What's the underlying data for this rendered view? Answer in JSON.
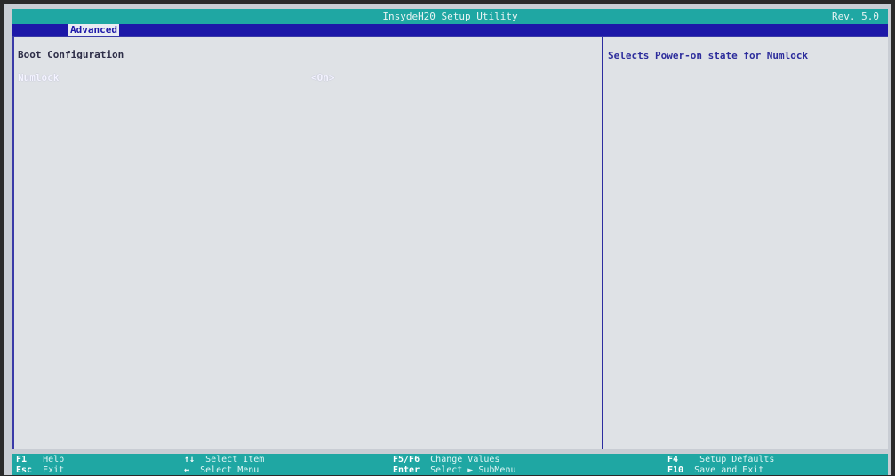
{
  "title": "InsydeH20 Setup Utility",
  "revision": "Rev. 5.0",
  "active_tab": "Advanced",
  "section_title": "Boot Configuration",
  "options": [
    {
      "label": "Numlock",
      "value": "<On>"
    }
  ],
  "help_text": "Selects Power-on state for Numlock",
  "footer": {
    "col1": [
      {
        "key": "F1",
        "desc": "Help"
      },
      {
        "key": "Esc",
        "desc": "Exit"
      }
    ],
    "col2": [
      {
        "key": "↑↓",
        "desc": "Select Item"
      },
      {
        "key": "↔",
        "desc": "Select Menu"
      }
    ],
    "col3": [
      {
        "key": "F5/F6",
        "desc": "Change Values"
      },
      {
        "key": "Enter",
        "desc": "Select ► SubMenu"
      }
    ],
    "col4": [
      {
        "key": "F4",
        "desc": "Setup Defaults"
      },
      {
        "key": "F10",
        "desc": "Save and Exit"
      }
    ]
  },
  "colors": {
    "title_bar": "#1fa7a3",
    "tab_bar": "#1d18a8",
    "panel_bg": "#dfe2e6",
    "help_text": "#2d2d9c"
  }
}
